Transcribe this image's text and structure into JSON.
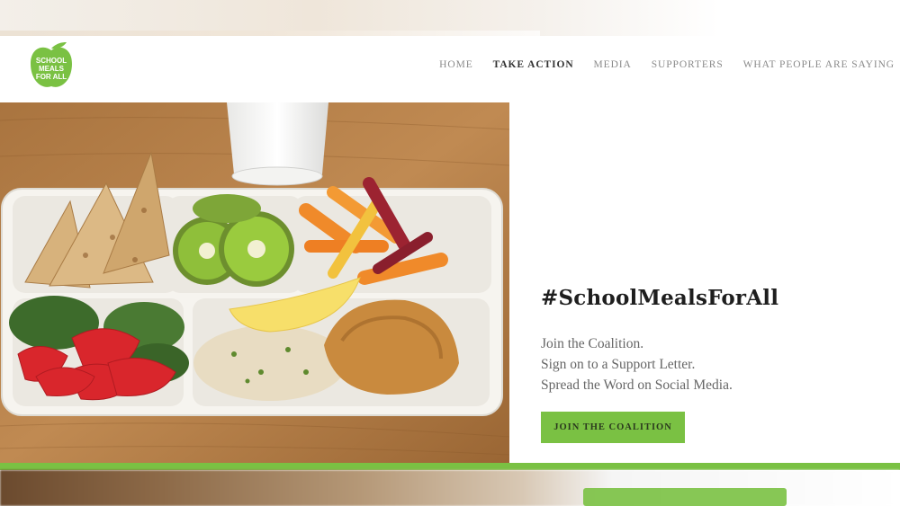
{
  "logo": {
    "text_lines": [
      "SCHOOL",
      "MEALS",
      "FOR ALL"
    ],
    "color": "#7ac143"
  },
  "nav": {
    "items": [
      {
        "label": "HOME",
        "active": false
      },
      {
        "label": "TAKE ACTION",
        "active": true
      },
      {
        "label": "MEDIA",
        "active": false
      },
      {
        "label": "SUPPORTERS",
        "active": false
      },
      {
        "label": "WHAT PEOPLE ARE SAYING",
        "active": false
      }
    ]
  },
  "hero": {
    "hashtag": "#SchoolMealsForAll",
    "lines": [
      "Join the Coalition.",
      "Sign on to a Support Letter.",
      "Spread the Word on Social Media."
    ],
    "cta_label": "JOIN THE COALITION"
  },
  "colors": {
    "accent": "#7ac143",
    "text_dark": "#1e1e1e",
    "text_muted": "#666666"
  }
}
